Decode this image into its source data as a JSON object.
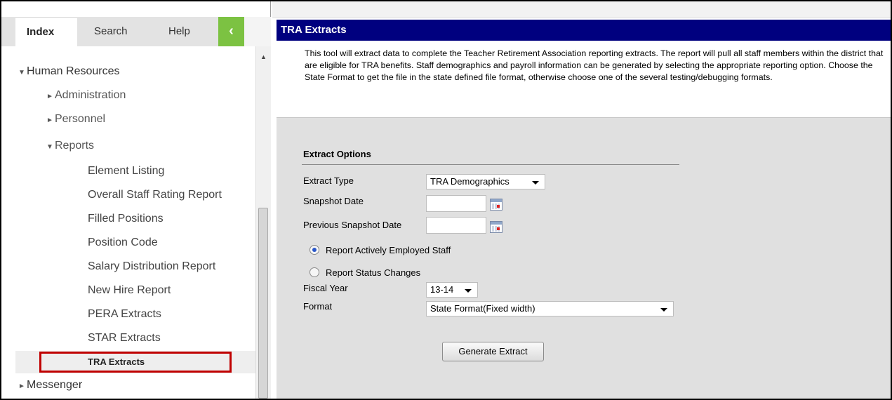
{
  "sidebar": {
    "tabs": {
      "index": "Index",
      "search": "Search",
      "help": "Help",
      "collapse": "‹"
    },
    "tree": {
      "human_resources": "Human Resources",
      "administration": "Administration",
      "personnel": "Personnel",
      "reports": "Reports",
      "items": [
        "Element Listing",
        "Overall Staff Rating Report",
        "Filled Positions",
        "Position Code",
        "Salary Distribution Report",
        "New Hire Report",
        "PERA Extracts",
        "STAR Extracts",
        "TRA Extracts"
      ],
      "messenger": "Messenger"
    }
  },
  "main": {
    "title": "TRA Extracts",
    "description": "This tool will extract data to complete the Teacher Retirement Association reporting extracts. The report will pull all staff members within the district that are eligible for TRA benefits. Staff demographics and payroll information can be generated by selecting the appropriate reporting option. Choose the State Format to get the file in the state defined file format, otherwise choose one of the several testing/debugging formats.",
    "options_title": "Extract Options",
    "extract_type": {
      "label": "Extract Type",
      "value": "TRA Demographics"
    },
    "snapshot_date": {
      "label": "Snapshot Date",
      "value": ""
    },
    "previous_snapshot_date": {
      "label": "Previous Snapshot Date",
      "value": ""
    },
    "radio_active": {
      "label": "Report Actively Employed Staff",
      "checked": true
    },
    "radio_status": {
      "label": "Report Status Changes",
      "checked": false
    },
    "fiscal_year": {
      "label": "Fiscal Year",
      "value": "13-14"
    },
    "format": {
      "label": "Format",
      "value": "State Format(Fixed width)"
    },
    "generate_button": "Generate Extract"
  },
  "colors": {
    "title_bar": "#00007f",
    "collapse_button": "#7cc242",
    "highlight_border": "#c00000",
    "content_bg": "#e0e0e0"
  }
}
